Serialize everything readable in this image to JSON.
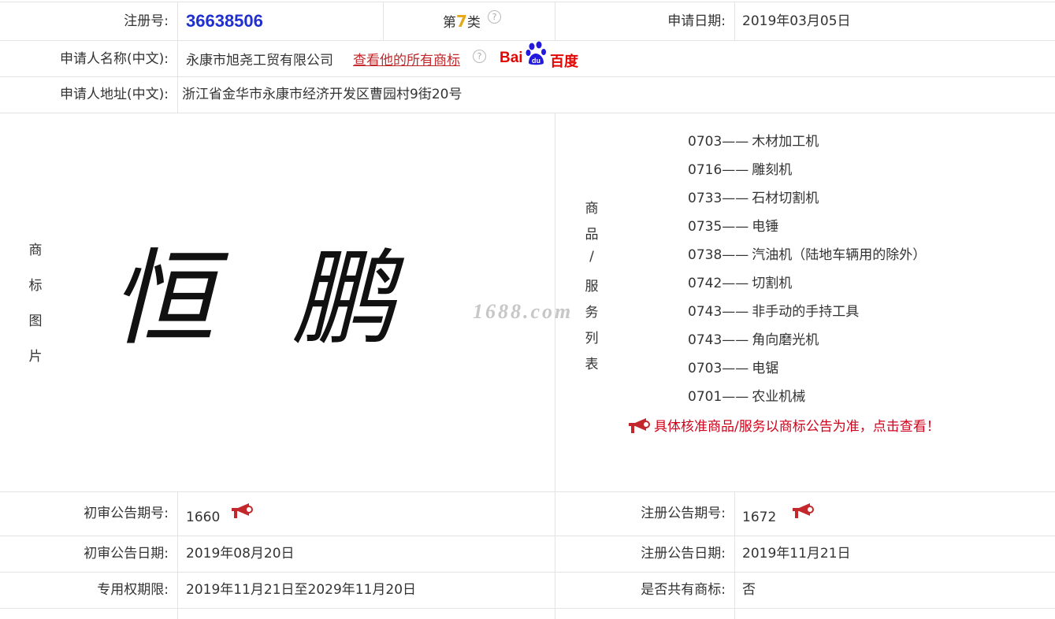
{
  "row1": {
    "reg_label": "注册号:",
    "reg_no": "36638506",
    "class_prefix": "第",
    "class_num": "7",
    "class_suffix": "类",
    "app_date_label": "申请日期:",
    "app_date": "2019年03月05日"
  },
  "row2": {
    "name_label": "申请人名称(中文):",
    "name": "永康市旭尧工贸有限公司",
    "all_marks_link": "查看他的所有商标",
    "baidu_left": "Bai",
    "baidu_right": "百度"
  },
  "row3": {
    "addr_label": "申请人地址(中文):",
    "addr": "浙江省金华市永康市经济开发区曹园村9街20号"
  },
  "image_section": {
    "label_chars": [
      "商",
      "标",
      "图",
      "片"
    ],
    "trademark_text": "恒 鹏",
    "watermark": "1688.com"
  },
  "goods_section": {
    "label_chars": [
      "商",
      "品",
      "/",
      "服",
      "务",
      "列",
      "表"
    ],
    "items": [
      {
        "code": "0703——",
        "name": "木材加工机"
      },
      {
        "code": "0716——",
        "name": "雕刻机"
      },
      {
        "code": "0733——",
        "name": "石材切割机"
      },
      {
        "code": "0735——",
        "name": "电锤"
      },
      {
        "code": "0738——",
        "name": "汽油机（陆地车辆用的除外）"
      },
      {
        "code": "0742——",
        "name": "切割机"
      },
      {
        "code": "0743——",
        "name": "非手动的手持工具"
      },
      {
        "code": "0743——",
        "name": "角向磨光机"
      },
      {
        "code": "0703——",
        "name": "电锯"
      },
      {
        "code": "0701——",
        "name": "农业机械"
      }
    ],
    "notice": "具体核准商品/服务以商标公告为准，点击查看！"
  },
  "row5": {
    "prelim_no_label": "初审公告期号:",
    "prelim_no": "1660",
    "reg_pub_no_label": "注册公告期号:",
    "reg_pub_no": "1672"
  },
  "row6": {
    "prelim_date_label": "初审公告日期:",
    "prelim_date": "2019年08月20日",
    "reg_pub_date_label": "注册公告日期:",
    "reg_pub_date": "2019年11月21日"
  },
  "row7": {
    "period_label": "专用权期限:",
    "period": "2019年11月21日至2029年11月20日",
    "shared_label": "是否共有商标:",
    "shared": "否"
  },
  "colors": {
    "reg_no": "#1f2fd0",
    "class_num": "#e6a817",
    "link": "#c3292c",
    "notice": "#d0021b",
    "baidu_red": "#e10601",
    "baidu_blue": "#2319dc",
    "border": "#e3e3e3"
  },
  "icons": {
    "help": "question-circle-icon",
    "megaphone": "megaphone-icon",
    "baidu_paw": "baidu-paw-icon"
  }
}
